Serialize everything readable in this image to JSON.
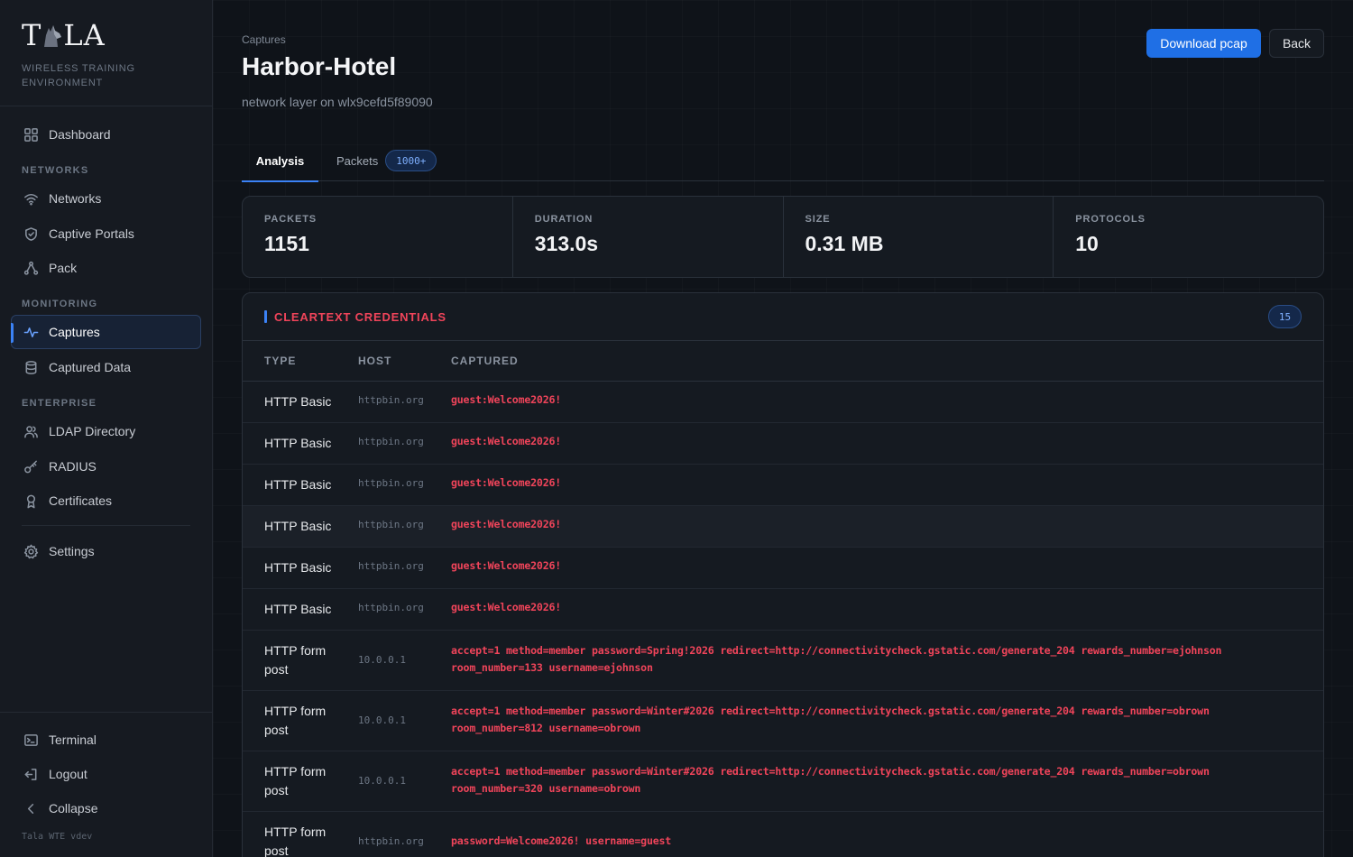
{
  "brand": {
    "logo_text_left": "T",
    "logo_text_right": "LA",
    "tagline": "WIRELESS TRAINING ENVIRONMENT"
  },
  "sidebar": {
    "dashboard": "Dashboard",
    "section_networks": "NETWORKS",
    "networks": "Networks",
    "captive_portals": "Captive Portals",
    "pack": "Pack",
    "section_monitoring": "MONITORING",
    "captures": "Captures",
    "captured_data": "Captured Data",
    "section_enterprise": "ENTERPRISE",
    "ldap": "LDAP Directory",
    "radius": "RADIUS",
    "certificates": "Certificates",
    "settings": "Settings",
    "terminal": "Terminal",
    "logout": "Logout",
    "collapse": "Collapse",
    "version": "Tala WTE vdev"
  },
  "header": {
    "breadcrumb": "Captures",
    "title": "Harbor-Hotel",
    "subtitle": "network layer on wlx9cefd5f89090",
    "download_label": "Download pcap",
    "back_label": "Back"
  },
  "tabs": {
    "analysis": "Analysis",
    "packets": "Packets",
    "packets_badge": "1000+"
  },
  "stats": [
    {
      "label": "PACKETS",
      "value": "1151"
    },
    {
      "label": "DURATION",
      "value": "313.0s"
    },
    {
      "label": "SIZE",
      "value": "0.31 MB"
    },
    {
      "label": "PROTOCOLS",
      "value": "10"
    }
  ],
  "credentials": {
    "title": "CLEARTEXT CREDENTIALS",
    "count": "15",
    "columns": {
      "type": "TYPE",
      "host": "HOST",
      "captured": "CAPTURED"
    },
    "rows": [
      {
        "type": "HTTP Basic",
        "host": "httpbin.org",
        "captured": "guest:Welcome2026!"
      },
      {
        "type": "HTTP Basic",
        "host": "httpbin.org",
        "captured": "guest:Welcome2026!"
      },
      {
        "type": "HTTP Basic",
        "host": "httpbin.org",
        "captured": "guest:Welcome2026!"
      },
      {
        "type": "HTTP Basic",
        "host": "httpbin.org",
        "captured": "guest:Welcome2026!"
      },
      {
        "type": "HTTP Basic",
        "host": "httpbin.org",
        "captured": "guest:Welcome2026!"
      },
      {
        "type": "HTTP Basic",
        "host": "httpbin.org",
        "captured": "guest:Welcome2026!"
      },
      {
        "type": "HTTP form post",
        "host": "10.0.0.1",
        "captured": "accept=1 method=member password=Spring!2026 redirect=http://connectivitycheck.gstatic.com/generate_204 rewards_number=ejohnson room_number=133 username=ejohnson"
      },
      {
        "type": "HTTP form post",
        "host": "10.0.0.1",
        "captured": "accept=1 method=member password=Winter#2026 redirect=http://connectivitycheck.gstatic.com/generate_204 rewards_number=obrown room_number=812 username=obrown"
      },
      {
        "type": "HTTP form post",
        "host": "10.0.0.1",
        "captured": "accept=1 method=member password=Winter#2026 redirect=http://connectivitycheck.gstatic.com/generate_204 rewards_number=obrown room_number=320 username=obrown"
      },
      {
        "type": "HTTP form post",
        "host": "httpbin.org",
        "captured": "password=Welcome2026! username=guest"
      }
    ]
  }
}
